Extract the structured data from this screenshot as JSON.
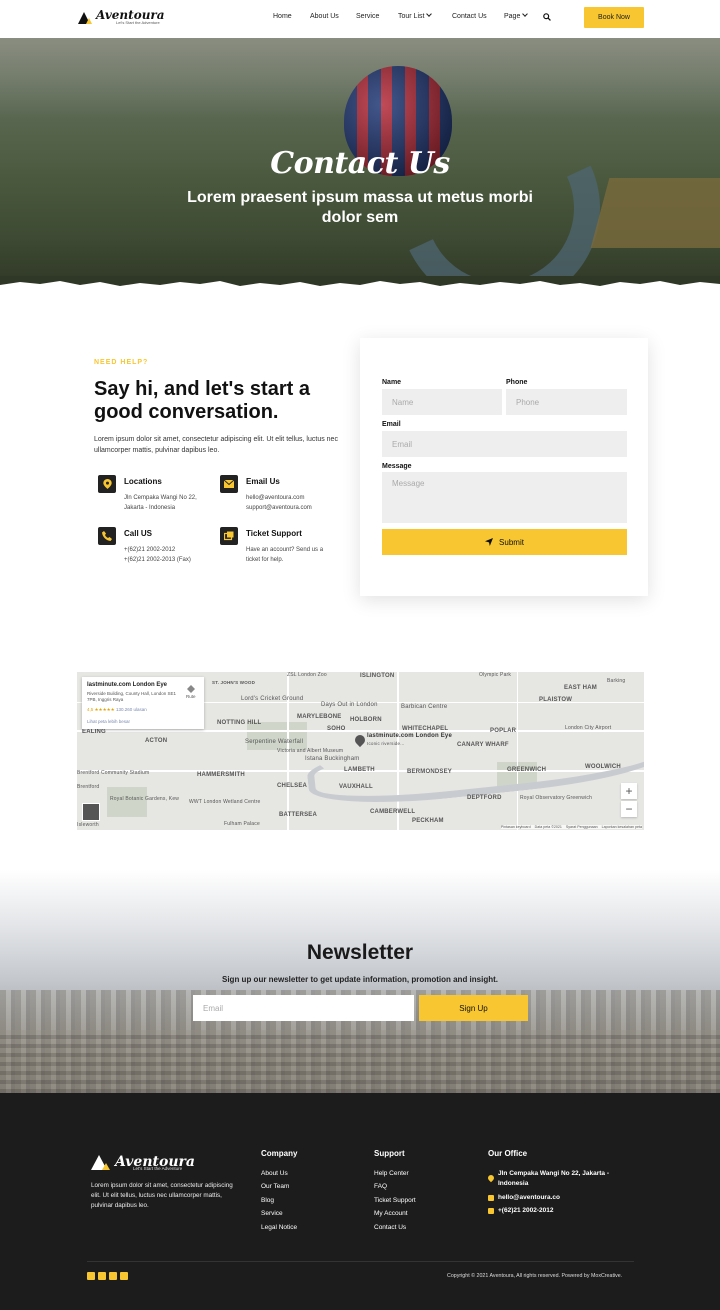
{
  "brand": {
    "name": "Aventoura",
    "tagline": "Let's Start the Adventure"
  },
  "nav": {
    "items": [
      "Home",
      "About Us",
      "Service",
      "Tour List",
      "Contact Us",
      "Page"
    ],
    "book_label": "Book Now"
  },
  "hero": {
    "title": "Contact Us",
    "subtitle": "Lorem praesent ipsum massa ut metus morbi dolor sem"
  },
  "contact": {
    "eyebrow": "NEED HELP?",
    "heading": "Say hi, and let's start a good conversation.",
    "intro": "Lorem ipsum dolor sit amet, consectetur adipiscing elit. Ut elit tellus, luctus nec ullamcorper mattis, pulvinar dapibus leo.",
    "info": [
      {
        "title": "Locations",
        "lines": [
          "Jln Cempaka Wangi No 22,",
          "Jakarta - Indonesia"
        ],
        "icon": "map-pin-icon"
      },
      {
        "title": "Email Us",
        "lines": [
          "hello@aventoura.com",
          "support@aventoura.com"
        ],
        "icon": "envelope-icon"
      },
      {
        "title": "Call US",
        "lines": [
          "+(62)21 2002-2012",
          "+(62)21 2002-2013 (Fax)"
        ],
        "icon": "phone-icon"
      },
      {
        "title": "Ticket Support",
        "lines": [
          "Have an account? Send us a",
          "ticket for help."
        ],
        "icon": "ticket-icon"
      }
    ]
  },
  "form": {
    "name_label": "Name",
    "name_placeholder": "Name",
    "phone_label": "Phone",
    "phone_placeholder": "Phone",
    "email_label": "Email",
    "email_placeholder": "Email",
    "message_label": "Message",
    "message_placeholder": "Message",
    "submit_label": "Submit"
  },
  "map": {
    "place_title": "lastminute.com London Eye",
    "place_address": "Riverside Building, County Hall, London SE1 7PB, Inggris Raya",
    "rating": "4,5 ★★★★★",
    "reviews": "130.260 ulasan",
    "larger_map": "Lihat peta lebih besar",
    "route": "Rute",
    "pin_label": "lastminute.com London Eye",
    "pin_sub": "Iconic riverside...",
    "labels": [
      "ISLINGTON",
      "EAST HAM",
      "PLAISTOW",
      "ST. JOHN'S WOOD",
      "Lord's Cricket Ground",
      "MARYLEBONE",
      "HOLBORN",
      "NOTTING HILL",
      "SOHO",
      "WHITECHAPEL",
      "POPLAR",
      "CANARY WHARF",
      "ACTON",
      "Serpentine Waterfall",
      "Barbican Centre",
      "Days Out in London",
      "Istana Buckingham",
      "LAMBETH",
      "BERMONDSEY",
      "GREENWICH",
      "WOOLWICH",
      "HAMMERSMITH",
      "CHELSEA",
      "VAUXHALL",
      "DEPTFORD",
      "BATTERSEA",
      "CAMBERWELL",
      "PECKHAM",
      "Brentford Community Stadium",
      "Royal Botanic Gardens, Kew",
      "WWT London Wetland Centre",
      "Fulham Palace",
      "Royal Observatory Greenwich",
      "London City Airport",
      "Victoria and Albert Museum",
      "EALING",
      "Olympic Park",
      "ZSL London Zoo",
      "Barking",
      "Brentford",
      "Isleworth"
    ],
    "footer": [
      "Pintasan keyboard",
      "Data peta ©2021",
      "Syarat Penggunaan",
      "Laporkan kesalahan peta"
    ]
  },
  "newsletter": {
    "title": "Newsletter",
    "subtitle": "Sign up our newsletter to get update information, promotion and insight.",
    "email_placeholder": "Email",
    "button_label": "Sign Up"
  },
  "footer": {
    "description": "Lorem ipsum dolor sit amet, consectetur adipiscing elit. Ut elit tellus, luctus nec ullamcorper mattis, pulvinar dapibus leo.",
    "company_title": "Company",
    "company_links": [
      "About Us",
      "Our Team",
      "Blog",
      "Service",
      "Legal Notice"
    ],
    "support_title": "Support",
    "support_links": [
      "Help Center",
      "FAQ",
      "Ticket Support",
      "My Account",
      "Contact Us"
    ],
    "office_title": "Our Office",
    "office_address": "Jln Cempaka Wangi No 22, Jakarta - Indonesia",
    "office_email": "hello@aventoura.co",
    "office_phone": "+(62)21 2002-2012",
    "copyright": "Copyright © 2021 Aventoura, All rights reserved. Powered by MoxCreative."
  },
  "colors": {
    "accent": "#f7c631",
    "dark": "#1c1c1c"
  }
}
